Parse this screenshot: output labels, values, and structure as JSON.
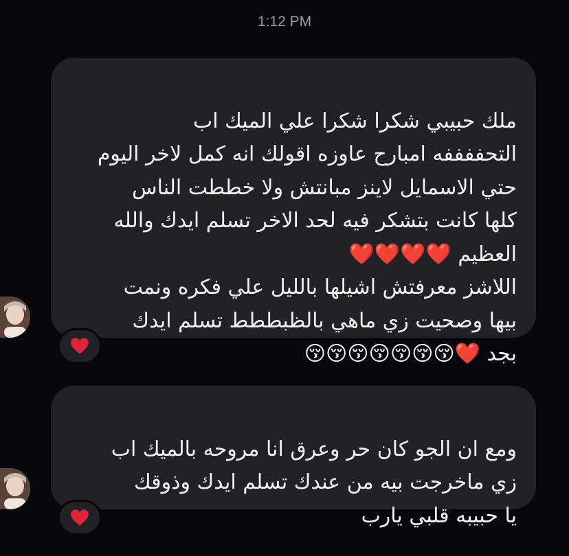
{
  "header": {
    "timestamp": "1:12 PM"
  },
  "messages": [
    {
      "text": "ملك حبيبي شكرا شكرا علي الميك اب\nالتحففففه امبارح عاوزه اقولك انه كمل لاخر اليوم\nحتي الاسمايل لاينز مبانتش ولا خططت الناس\nكلها كانت بتشكر فيه لحد الاخر تسلم ايدك والله\nالعظيم ❤️❤️❤️❤️\nاللاشز معرفتش اشيلها بالليل علي فكره ونمت\nبيها وصحيت زي ماهي بالظبططط تسلم ايدك\nبجد ❤️😚😚😚😚😚😚😚",
      "reaction": "❤️"
    },
    {
      "text": "ومع ان الجو كان حر وعرق انا مروحه بالميك اب\nزي ماخرجت بيه من عندك تسلم ايدك وذوقك\nيا حبيبه قلبي يارب",
      "reaction": "❤️"
    }
  ],
  "colors": {
    "background": "#07080d",
    "bubble": "#202226",
    "text": "#f3f3f5",
    "timestamp": "#9a9ca4",
    "heart": "#e0243a"
  },
  "icons": {
    "avatar": "sender-avatar-photo",
    "reaction": "red-heart-icon"
  }
}
